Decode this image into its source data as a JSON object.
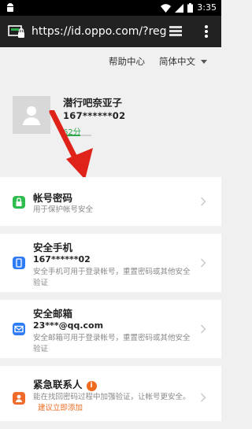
{
  "status_bar": {
    "time": "3:35",
    "icons": [
      "android-icon",
      "wifi-icon",
      "signal-icon",
      "battery-icon"
    ]
  },
  "browser": {
    "url": "https://id.oppo.com/?reg",
    "icons": [
      "page-icon",
      "tabs-icon",
      "overflow-menu-icon"
    ]
  },
  "top_links": {
    "help": "帮助中心",
    "language": "简体中文"
  },
  "profile": {
    "username": "潜行吧奈亚子",
    "phone": "167******02",
    "security_score": "62分",
    "security_level": 0.62
  },
  "settings": [
    {
      "title": "帐号密码",
      "value": "",
      "description": "用于保护帐号安全",
      "icon": "lock-icon",
      "icon_color": "#2fbd4f"
    },
    {
      "title": "安全手机",
      "value": "167******02",
      "description": "安全手机可用于登录帐号，重置密码或其他安全验证",
      "icon": "phone-icon",
      "icon_color": "#2d7cf6"
    },
    {
      "title": "安全邮箱",
      "value": "23***@qq.com",
      "description": "安全邮箱可用于登录帐号，重置密码或其他安全验证",
      "icon": "mail-icon",
      "icon_color": "#2d7cf6"
    },
    {
      "title": "紧急联系人",
      "value": "",
      "description": "能在找回密码过程中加强验证，让帐号更安全。",
      "link": "建议立即添加",
      "info_icon": "i",
      "icon": "contact-icon",
      "icon_color": "#f06a2a"
    }
  ],
  "colors": {
    "accent_green": "#2ea84a",
    "accent_orange": "#ef6a1f",
    "arrow_red": "#e0231a"
  }
}
